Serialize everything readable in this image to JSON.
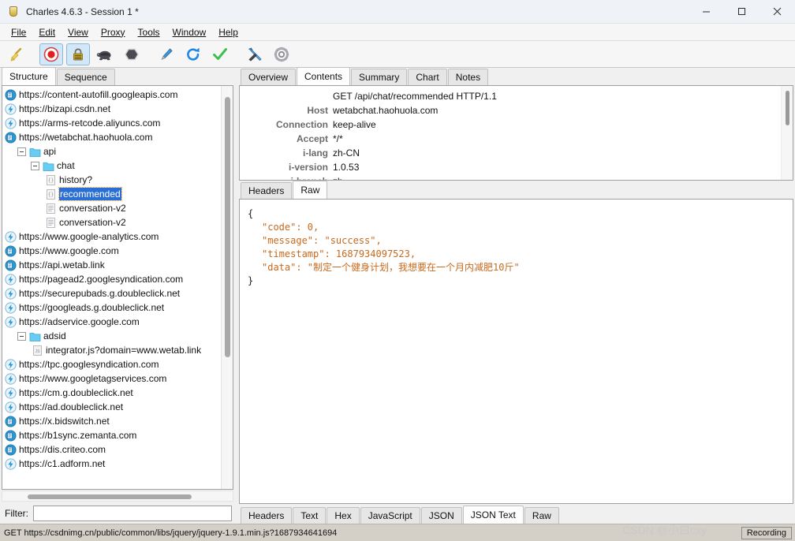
{
  "window": {
    "title": "Charles 4.6.3 - Session 1 *",
    "app_icon": "charles-bottle-icon",
    "minimize_label": "Minimize",
    "maximize_label": "Maximize",
    "close_label": "Close"
  },
  "menubar": {
    "items": [
      {
        "label": "File",
        "mnemonic": "F"
      },
      {
        "label": "Edit",
        "mnemonic": "E"
      },
      {
        "label": "View",
        "mnemonic": "V"
      },
      {
        "label": "Proxy",
        "mnemonic": "P"
      },
      {
        "label": "Tools",
        "mnemonic": "T"
      },
      {
        "label": "Window",
        "mnemonic": "W"
      },
      {
        "label": "Help",
        "mnemonic": "H"
      }
    ]
  },
  "toolbar": {
    "buttons": [
      {
        "name": "clear-session-icon",
        "tooltip": "Clear Session",
        "active": false
      },
      {
        "name": "record-icon",
        "tooltip": "Start/Stop Recording",
        "active": true
      },
      {
        "name": "ssl-proxying-icon",
        "tooltip": "SSL Proxying",
        "active": true
      },
      {
        "name": "throttling-turtle-icon",
        "tooltip": "Start/Stop Throttling",
        "active": false
      },
      {
        "name": "breakpoints-icon",
        "tooltip": "Enable/Disable Breakpoints",
        "active": false
      },
      {
        "name": "compose-pen-icon",
        "tooltip": "Compose",
        "active": false
      },
      {
        "name": "repeat-refresh-icon",
        "tooltip": "Repeat",
        "active": false
      },
      {
        "name": "validate-check-icon",
        "tooltip": "Validate",
        "active": false
      },
      {
        "name": "tools-icon",
        "tooltip": "Tools",
        "active": false
      },
      {
        "name": "settings-gear-icon",
        "tooltip": "Settings",
        "active": false
      }
    ]
  },
  "left_panel": {
    "tabs": [
      {
        "label": "Structure",
        "active": true
      },
      {
        "label": "Sequence",
        "active": false
      }
    ],
    "tree": [
      {
        "label": "https://content-autofill.googleapis.com",
        "indent": 0,
        "icon": "host-globe-icon",
        "toggle": "none",
        "selected": false
      },
      {
        "label": "https://bizapi.csdn.net",
        "indent": 0,
        "icon": "host-bolt-icon",
        "toggle": "none",
        "selected": false
      },
      {
        "label": "https://arms-retcode.aliyuncs.com",
        "indent": 0,
        "icon": "host-bolt-icon",
        "toggle": "none",
        "selected": false
      },
      {
        "label": "https://wetabchat.haohuola.com",
        "indent": 0,
        "icon": "host-globe-icon",
        "toggle": "none",
        "selected": false
      },
      {
        "label": "api",
        "indent": 1,
        "icon": "folder-icon",
        "toggle": "expanded",
        "selected": false
      },
      {
        "label": "chat",
        "indent": 2,
        "icon": "folder-icon",
        "toggle": "expanded",
        "selected": false
      },
      {
        "label": "history?",
        "indent": 3,
        "icon": "json-file-icon",
        "toggle": "none",
        "selected": false
      },
      {
        "label": "recommended",
        "indent": 3,
        "icon": "json-file-icon",
        "toggle": "none",
        "selected": true
      },
      {
        "label": "conversation-v2",
        "indent": 3,
        "icon": "text-file-icon",
        "toggle": "none",
        "selected": false
      },
      {
        "label": "conversation-v2",
        "indent": 3,
        "icon": "text-file-icon",
        "toggle": "none",
        "selected": false
      },
      {
        "label": "https://www.google-analytics.com",
        "indent": 0,
        "icon": "host-bolt-icon",
        "toggle": "none",
        "selected": false
      },
      {
        "label": "https://www.google.com",
        "indent": 0,
        "icon": "host-globe-icon",
        "toggle": "none",
        "selected": false
      },
      {
        "label": "https://api.wetab.link",
        "indent": 0,
        "icon": "host-globe-icon",
        "toggle": "none",
        "selected": false
      },
      {
        "label": "https://pagead2.googlesyndication.com",
        "indent": 0,
        "icon": "host-bolt-icon",
        "toggle": "none",
        "selected": false
      },
      {
        "label": "https://securepubads.g.doubleclick.net",
        "indent": 0,
        "icon": "host-bolt-icon",
        "toggle": "none",
        "selected": false
      },
      {
        "label": "https://googleads.g.doubleclick.net",
        "indent": 0,
        "icon": "host-bolt-icon",
        "toggle": "none",
        "selected": false
      },
      {
        "label": "https://adservice.google.com",
        "indent": 0,
        "icon": "host-bolt-icon",
        "toggle": "none",
        "selected": false
      },
      {
        "label": "adsid",
        "indent": 1,
        "icon": "folder-icon",
        "toggle": "expanded",
        "selected": false
      },
      {
        "label": "integrator.js?domain=www.wetab.link",
        "indent": 2,
        "icon": "js-file-icon",
        "toggle": "none",
        "selected": false
      },
      {
        "label": "https://tpc.googlesyndication.com",
        "indent": 0,
        "icon": "host-bolt-icon",
        "toggle": "none",
        "selected": false
      },
      {
        "label": "https://www.googletagservices.com",
        "indent": 0,
        "icon": "host-bolt-icon",
        "toggle": "none",
        "selected": false
      },
      {
        "label": "https://cm.g.doubleclick.net",
        "indent": 0,
        "icon": "host-bolt-icon",
        "toggle": "none",
        "selected": false
      },
      {
        "label": "https://ad.doubleclick.net",
        "indent": 0,
        "icon": "host-bolt-icon",
        "toggle": "none",
        "selected": false
      },
      {
        "label": "https://x.bidswitch.net",
        "indent": 0,
        "icon": "host-globe-icon",
        "toggle": "none",
        "selected": false
      },
      {
        "label": "https://b1sync.zemanta.com",
        "indent": 0,
        "icon": "host-globe-icon",
        "toggle": "none",
        "selected": false
      },
      {
        "label": "https://dis.criteo.com",
        "indent": 0,
        "icon": "host-globe-icon",
        "toggle": "none",
        "selected": false
      },
      {
        "label": "https://c1.adform.net",
        "indent": 0,
        "icon": "host-bolt-icon",
        "toggle": "none",
        "selected": false
      }
    ],
    "filter": {
      "label": "Filter:",
      "value": "",
      "placeholder": ""
    }
  },
  "right_panel": {
    "tabs": [
      {
        "label": "Overview",
        "active": false
      },
      {
        "label": "Contents",
        "active": true
      },
      {
        "label": "Summary",
        "active": false
      },
      {
        "label": "Chart",
        "active": false
      },
      {
        "label": "Notes",
        "active": false
      }
    ],
    "request": {
      "request_line": "GET /api/chat/recommended HTTP/1.1",
      "headers": [
        {
          "name": "Host",
          "value": "wetabchat.haohuola.com"
        },
        {
          "name": "Connection",
          "value": "keep-alive"
        },
        {
          "name": "Accept",
          "value": "*/*"
        },
        {
          "name": "i-lang",
          "value": "zh-CN"
        },
        {
          "name": "i-version",
          "value": "1.0.53"
        },
        {
          "name": "i-branch",
          "value": "zh"
        }
      ]
    },
    "request_tabs": [
      {
        "label": "Headers",
        "active": false
      },
      {
        "label": "Raw",
        "active": true
      }
    ],
    "response_body": {
      "lines": [
        {
          "indent": 0,
          "text": "{"
        },
        {
          "indent": 1,
          "text": "\"code\": 0,"
        },
        {
          "indent": 1,
          "text": "\"message\": \"success\","
        },
        {
          "indent": 1,
          "text": "\"timestamp\": 1687934097523,"
        },
        {
          "indent": 1,
          "text": "\"data\": \"制定一个健身计划，我想要在一个月内减肥10斤\""
        },
        {
          "indent": 0,
          "text": "}"
        }
      ]
    },
    "response_tabs": [
      {
        "label": "Headers",
        "active": false
      },
      {
        "label": "Text",
        "active": false
      },
      {
        "label": "Hex",
        "active": false
      },
      {
        "label": "JavaScript",
        "active": false
      },
      {
        "label": "JSON",
        "active": false
      },
      {
        "label": "JSON Text",
        "active": true
      },
      {
        "label": "Raw",
        "active": false
      }
    ]
  },
  "statusbar": {
    "text": "GET https://csdnimg.cn/public/common/libs/jquery/jquery-1.9.1.min.js?1687934641694",
    "recording_label": "Recording"
  },
  "watermark": {
    "text": "CSDN @小白cxy"
  },
  "colors": {
    "selection_blue": "#2a6fd4",
    "focus_orange": "#f0a030",
    "json_orange": "#c76a1d",
    "header_gray": "#6b6b6b",
    "record_red": "#e02020",
    "folder_blue": "#5cc8f0"
  }
}
